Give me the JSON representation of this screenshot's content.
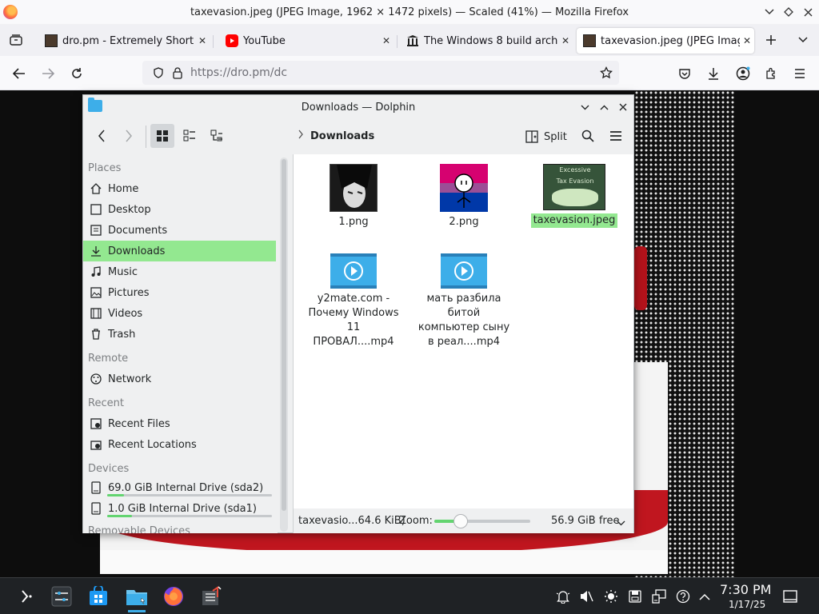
{
  "firefox": {
    "window_title": "taxevasion.jpeg (JPEG Image, 1962 × 1472 pixels) — Scaled (41%) — Mozilla Firefox",
    "tabs": [
      {
        "label": "dro.pm - Extremely Short L",
        "close": "✕"
      },
      {
        "label": "YouTube",
        "close": "✕"
      },
      {
        "label": "The Windows 8 build archi",
        "close": "✕"
      },
      {
        "label": "taxevasion.jpeg (JPEG Imag",
        "close": "✕"
      }
    ],
    "url_text": "https://dro.pm/dc"
  },
  "dolphin": {
    "window_title": "Downloads — Dolphin",
    "breadcrumb": "Downloads",
    "split_label": "Split",
    "places": {
      "sections": {
        "places": "Places",
        "remote": "Remote",
        "recent": "Recent",
        "devices": "Devices",
        "removable": "Removable Devices"
      },
      "items": [
        {
          "label": "Home",
          "icon": "home-icon"
        },
        {
          "label": "Desktop",
          "icon": "desktop-icon"
        },
        {
          "label": "Documents",
          "icon": "documents-icon"
        },
        {
          "label": "Downloads",
          "icon": "downloads-icon"
        },
        {
          "label": "Music",
          "icon": "music-icon"
        },
        {
          "label": "Pictures",
          "icon": "pictures-icon"
        },
        {
          "label": "Videos",
          "icon": "videos-icon"
        },
        {
          "label": "Trash",
          "icon": "trash-icon"
        }
      ],
      "remote_items": [
        {
          "label": "Network",
          "icon": "network-icon"
        }
      ],
      "recent_items": [
        {
          "label": "Recent Files",
          "icon": "recent-files-icon"
        },
        {
          "label": "Recent Locations",
          "icon": "recent-locations-icon"
        }
      ],
      "devices": [
        {
          "label": "69.0 GiB Internal Drive (sda2)",
          "used_fraction": 0.1
        },
        {
          "label": "1.0 GiB Internal Drive (sda1)",
          "used_fraction": 0.15
        }
      ]
    },
    "files": [
      {
        "name": "1.png"
      },
      {
        "name": "2.png"
      },
      {
        "name": "taxevasion.jpeg",
        "thumb_text_top": "Excessive",
        "thumb_text_bottom": "Tax Evasion"
      },
      {
        "name": "y2mate.com - Почему Windows 11 ПРОВАЛ....mp4"
      },
      {
        "name": "мать разбила битой компьютер сыну в реал....mp4"
      }
    ],
    "status": {
      "selection": "taxevasio...64.6 KiB)",
      "zoom_label": "Zoom:",
      "zoom_fraction": 0.25,
      "free_space": "56.9 GiB free"
    }
  },
  "taskbar": {
    "time": "7:30 PM",
    "date": "1/17/25"
  },
  "colors": {
    "selection": "#93e890",
    "accent": "#3daee9",
    "taskbar": "#1f2225"
  }
}
